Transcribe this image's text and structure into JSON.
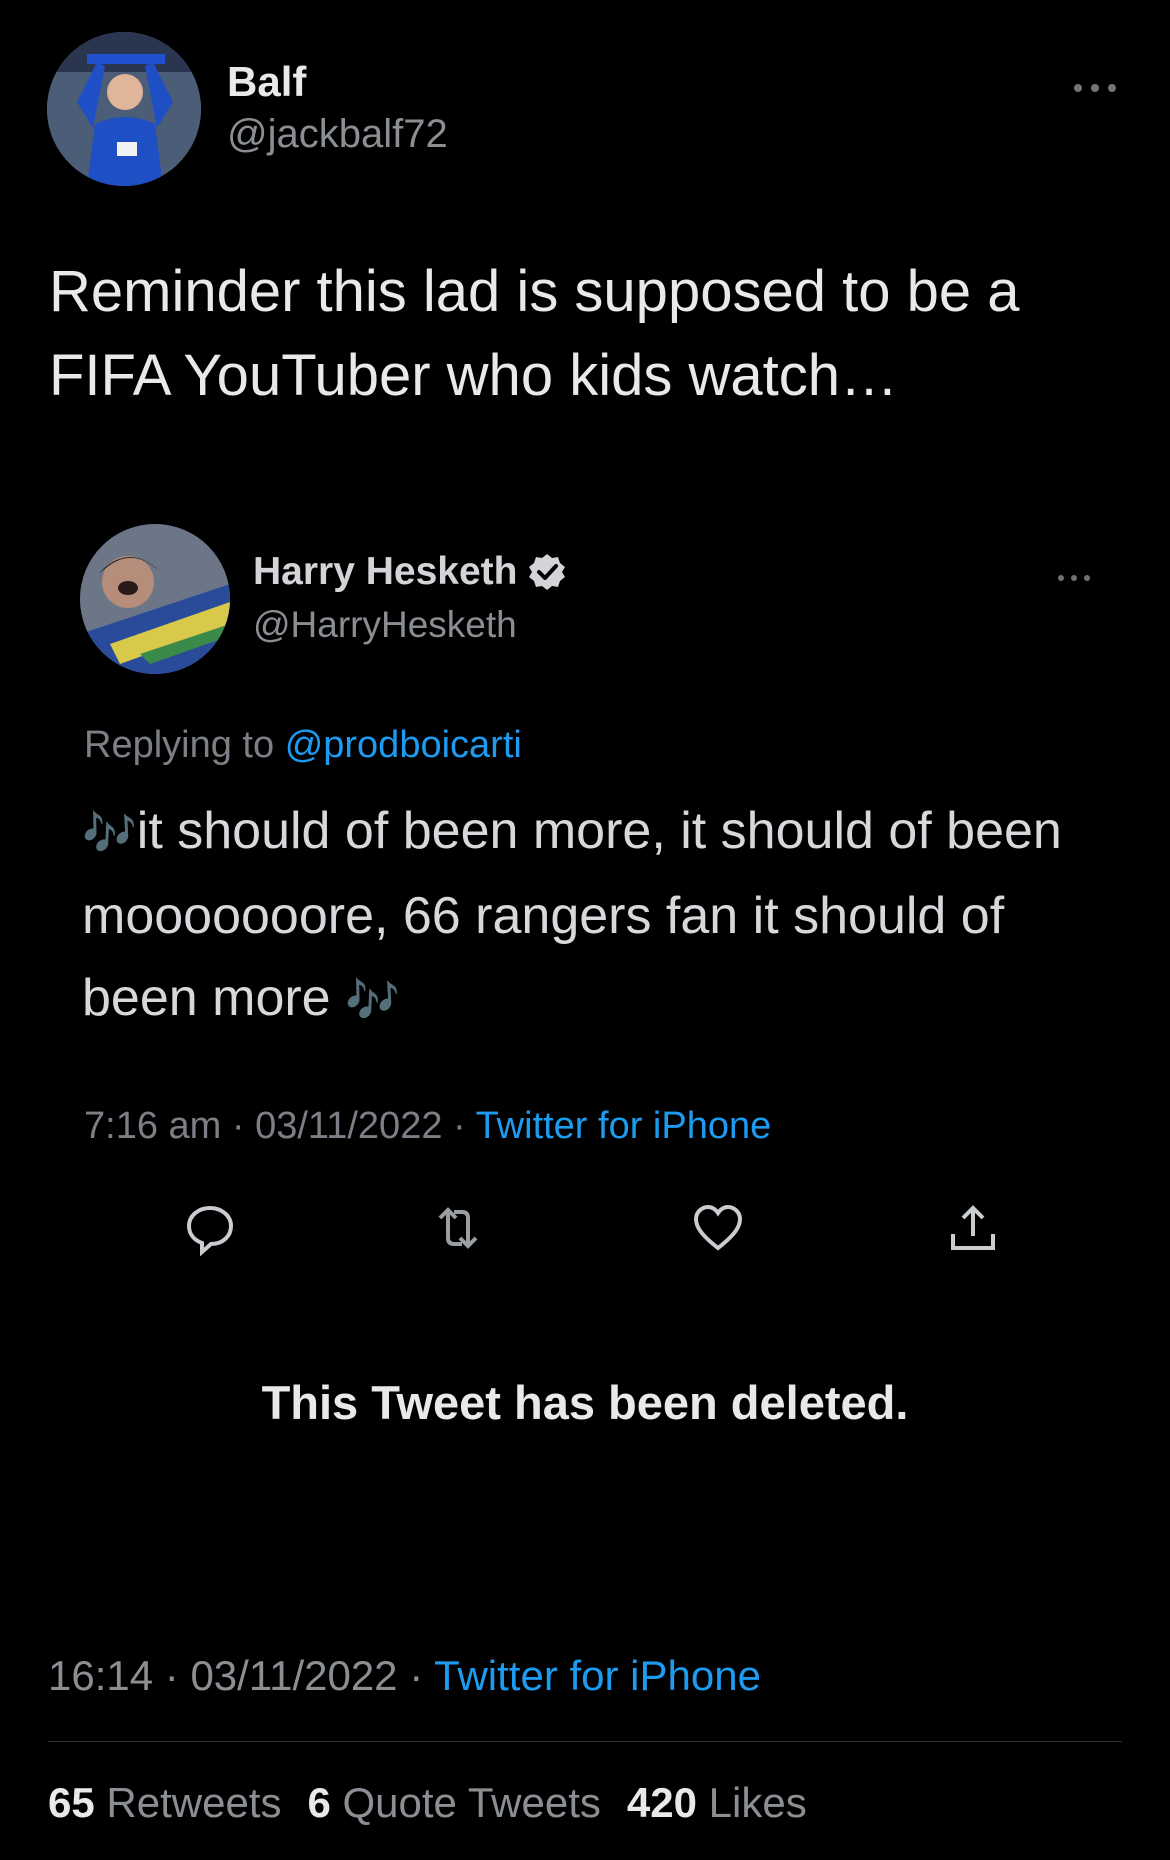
{
  "tweet": {
    "author_name": "Balf",
    "author_handle": "@jackbalf72",
    "more_icon": "more-horizontal-icon",
    "text": "Reminder this lad is supposed to be a FIFA YouTuber who kids watch…",
    "time": "16:14",
    "date": "03/11/2022",
    "source": "Twitter for iPhone",
    "sep": "·",
    "stats": {
      "retweets_count": "65",
      "retweets_label": "Retweets",
      "quotes_count": "6",
      "quotes_label": "Quote Tweets",
      "likes_count": "420",
      "likes_label": "Likes"
    }
  },
  "embedded": {
    "author_name": "Harry Hesketh",
    "author_handle": "@HarryHesketh",
    "replying_prefix": "Replying to",
    "replying_mention": "@prodboicarti",
    "text_main": "it should of been more, it should of been mooooooore, 66 rangers fan it should of been more",
    "note_glyph": "🎶",
    "time": "7:16 am",
    "date": "03/11/2022",
    "source": "Twitter for iPhone",
    "sep": "·",
    "deleted_notice": "This Tweet has been deleted.",
    "icons": [
      "reply-icon",
      "retweet-icon",
      "like-icon",
      "share-icon"
    ],
    "verified_color": "#d2d4d7"
  },
  "colors": {
    "background": "#000000",
    "link": "#1d9bf0"
  }
}
